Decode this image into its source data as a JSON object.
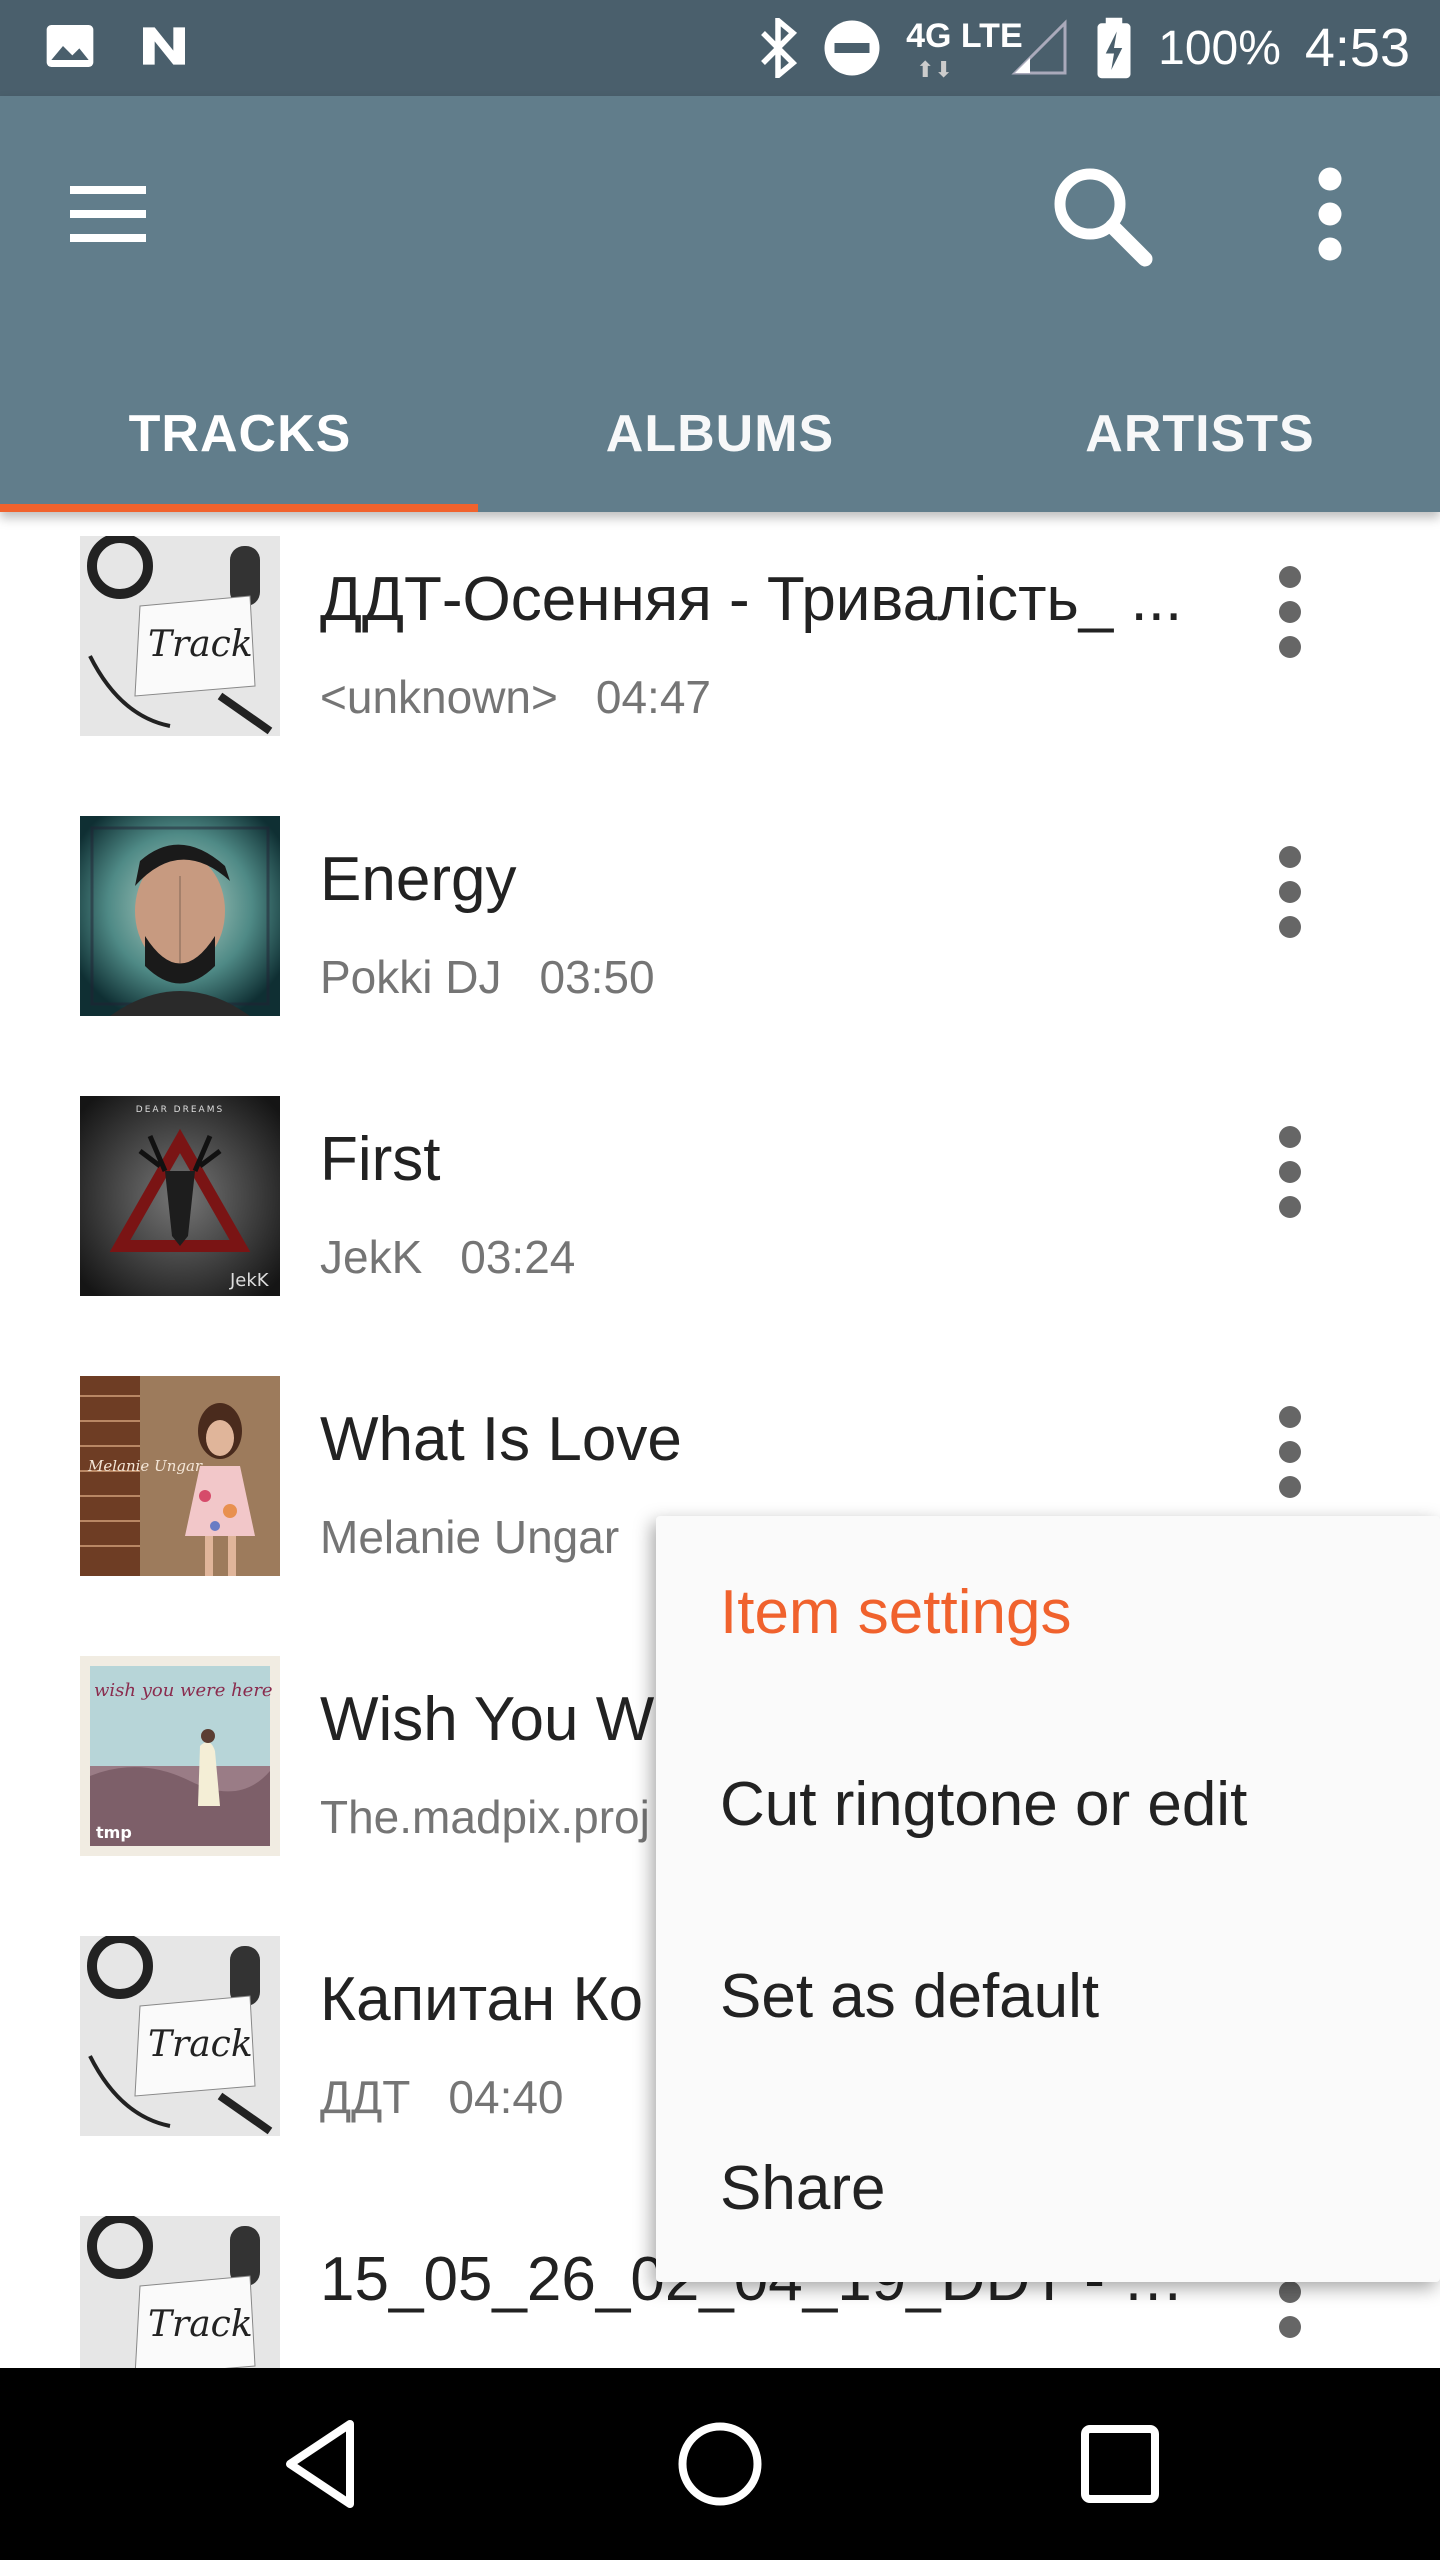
{
  "status_bar": {
    "battery": "100%",
    "time": "4:53",
    "network": "4G LTE"
  },
  "app_bar": {
    "icons": {
      "menu": "hamburger-menu-icon",
      "search": "search-icon",
      "more": "more-vert-icon"
    }
  },
  "tabs": [
    {
      "label": "TRACKS",
      "selected": true
    },
    {
      "label": "ALBUMS",
      "selected": false
    },
    {
      "label": "ARTISTS",
      "selected": false
    }
  ],
  "tracks": [
    {
      "title": "ДДТ-Осенняя - Тривалість_ ...",
      "artist": "<unknown>",
      "duration": "04:47"
    },
    {
      "title": "Energy",
      "artist": "Pokki DJ",
      "duration": "03:50"
    },
    {
      "title": "First",
      "artist": "JekK",
      "duration": "03:24"
    },
    {
      "title": "What Is Love",
      "artist": "Melanie Ungar",
      "duration": ""
    },
    {
      "title": "Wish You W",
      "artist": "The.madpix.proj",
      "duration": ""
    },
    {
      "title": "Капитан Ко",
      "artist": "ДДТ",
      "duration": "04:40"
    },
    {
      "title": "15_05_26_02_04_19_DDT - M...",
      "artist": "",
      "duration": ""
    }
  ],
  "popup_menu": {
    "items": [
      {
        "label": "Item settings",
        "accent": true
      },
      {
        "label": "Cut ringtone or edit",
        "accent": false
      },
      {
        "label": "Set as default",
        "accent": false
      },
      {
        "label": "Share",
        "accent": false
      }
    ]
  },
  "art_labels": {
    "track": "Track",
    "dear_dreams": "DEAR DREAMS",
    "jekk": "JekK",
    "melanie": "Melanie Ungar",
    "wish": "wish you were here",
    "tmp": "tmp"
  },
  "colors": {
    "status_bar": "#4a5f6c",
    "app_bar": "#617d8b",
    "accent": "#f0622d",
    "secondary_text": "#757575"
  }
}
